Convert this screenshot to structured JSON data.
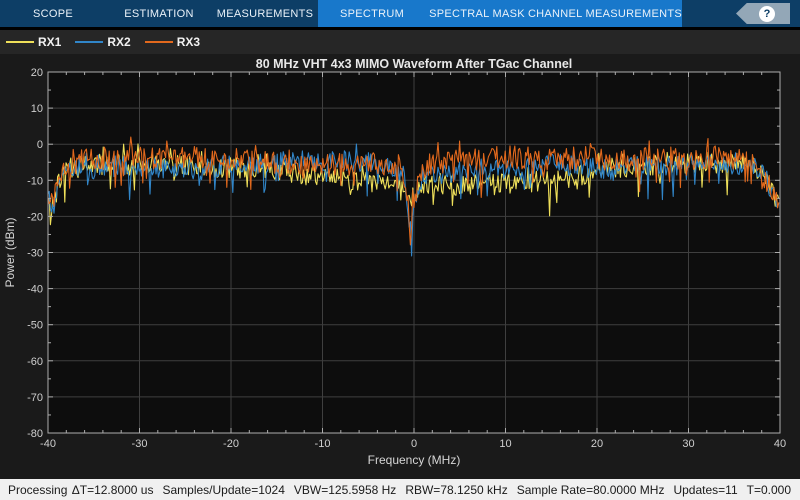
{
  "toolstrip": {
    "dark_tabs": [
      {
        "label": "SCOPE"
      },
      {
        "label": "ESTIMATION"
      },
      {
        "label": "MEASUREMENTS"
      }
    ],
    "blue_tabs": [
      {
        "label": "SPECTRUM"
      },
      {
        "label": "SPECTRAL MASK"
      },
      {
        "label": "CHANNEL MEASUREMENTS"
      }
    ],
    "help_label": "?",
    "colors": {
      "dark_bg": "#0D3E66",
      "blue_bg": "#1878CB",
      "help_tag": "#93A7B7"
    }
  },
  "legend": {
    "items": [
      {
        "label": "RX1",
        "color": "#EFE05A"
      },
      {
        "label": "RX2",
        "color": "#3186C9"
      },
      {
        "label": "RX3",
        "color": "#E2691D"
      }
    ]
  },
  "chart": {
    "title": "80 MHz VHT 4x3 MIMO Waveform After TGac Channel",
    "xlabel": "Frequency (MHz)",
    "ylabel": "Power (dBm)",
    "xlim": [
      -40,
      40
    ],
    "ylim": [
      -80,
      20
    ],
    "xticks": [
      -40,
      -30,
      -20,
      -10,
      0,
      10,
      20,
      30,
      40
    ],
    "yticks": [
      20,
      10,
      0,
      -10,
      -20,
      -30,
      -40,
      -50,
      -60,
      -70,
      -80
    ],
    "minor_x_step": 2,
    "minor_y_step": 5,
    "colors": {
      "figure_bg": "#1A1A1A",
      "plot_bg": "#0D0D0D",
      "grid": "#3F3F3F",
      "axis": "#ADADAD",
      "tick_text": "#CFCFCF",
      "label_text": "#D6D6D6"
    }
  },
  "chart_data": {
    "type": "line",
    "x_unit": "MHz",
    "y_unit": "dBm",
    "note": "Noisy spectral traces; envelope points [freq_MHz, dBm] estimated from plot, peak-to-peak noise ~6 dB with downward fading spikes",
    "series": [
      {
        "name": "RX1",
        "color": "#EFE05A",
        "seed": 42,
        "noise_db": 3.0,
        "envelope": [
          [
            -40,
            -15
          ],
          [
            -39.4,
            -18
          ],
          [
            -38.9,
            -11
          ],
          [
            -38,
            -7
          ],
          [
            -36,
            -6
          ],
          [
            -33,
            -5.5
          ],
          [
            -30,
            -5.5
          ],
          [
            -27,
            -6
          ],
          [
            -24,
            -6
          ],
          [
            -21,
            -6.5
          ],
          [
            -18,
            -7
          ],
          [
            -15,
            -7
          ],
          [
            -12,
            -8.5
          ],
          [
            -9,
            -9.5
          ],
          [
            -6,
            -10.5
          ],
          [
            -3,
            -11
          ],
          [
            -1,
            -12
          ],
          [
            -0.3,
            -17
          ],
          [
            0.5,
            -12
          ],
          [
            3,
            -11
          ],
          [
            6,
            -11.5
          ],
          [
            9,
            -11
          ],
          [
            12,
            -10.5
          ],
          [
            15,
            -10
          ],
          [
            18,
            -8.5
          ],
          [
            21,
            -7.5
          ],
          [
            24,
            -6.5
          ],
          [
            27,
            -6
          ],
          [
            30,
            -5
          ],
          [
            33,
            -5
          ],
          [
            35,
            -4.5
          ],
          [
            37,
            -6
          ],
          [
            38.3,
            -8
          ],
          [
            39,
            -12
          ],
          [
            39.5,
            -15
          ],
          [
            40,
            -16
          ]
        ]
      },
      {
        "name": "RX2",
        "color": "#3186C9",
        "seed": 777,
        "noise_db": 3.0,
        "envelope": [
          [
            -40,
            -14
          ],
          [
            -39.4,
            -19
          ],
          [
            -38.8,
            -10
          ],
          [
            -38,
            -7.5
          ],
          [
            -36,
            -7
          ],
          [
            -33,
            -6
          ],
          [
            -30,
            -6.5
          ],
          [
            -27,
            -7
          ],
          [
            -24,
            -7
          ],
          [
            -21,
            -6
          ],
          [
            -18,
            -6
          ],
          [
            -15,
            -5
          ],
          [
            -12,
            -4.5
          ],
          [
            -9,
            -4.5
          ],
          [
            -6,
            -5
          ],
          [
            -3,
            -5.5
          ],
          [
            -1,
            -8
          ],
          [
            -0.4,
            -24
          ],
          [
            0.4,
            -14
          ],
          [
            1.5,
            -9
          ],
          [
            4,
            -8
          ],
          [
            7,
            -7.5
          ],
          [
            10,
            -7
          ],
          [
            13,
            -6.5
          ],
          [
            15,
            -5.5
          ],
          [
            17,
            -6
          ],
          [
            20,
            -7
          ],
          [
            23,
            -6.5
          ],
          [
            26,
            -6
          ],
          [
            29,
            -5.5
          ],
          [
            32,
            -6
          ],
          [
            34,
            -6
          ],
          [
            36,
            -5.5
          ],
          [
            37.5,
            -7
          ],
          [
            38.5,
            -10
          ],
          [
            39.2,
            -14
          ],
          [
            40,
            -16
          ]
        ]
      },
      {
        "name": "RX3",
        "color": "#E2691D",
        "seed": 1309,
        "noise_db": 3.2,
        "envelope": [
          [
            -40,
            -13
          ],
          [
            -39.5,
            -17
          ],
          [
            -38.9,
            -9
          ],
          [
            -38,
            -5.5
          ],
          [
            -36,
            -4.5
          ],
          [
            -34,
            -4
          ],
          [
            -31,
            -3.5
          ],
          [
            -28,
            -4
          ],
          [
            -25,
            -3.5
          ],
          [
            -22,
            -4.5
          ],
          [
            -19,
            -4
          ],
          [
            -16,
            -5
          ],
          [
            -13,
            -6.5
          ],
          [
            -10,
            -6
          ],
          [
            -7,
            -5.5
          ],
          [
            -4,
            -5
          ],
          [
            -1.5,
            -5.5
          ],
          [
            -0.4,
            -21
          ],
          [
            0.5,
            -10
          ],
          [
            1.5,
            -5.5
          ],
          [
            4,
            -4.5
          ],
          [
            7,
            -4
          ],
          [
            10,
            -3.5
          ],
          [
            13,
            -4
          ],
          [
            16,
            -4.5
          ],
          [
            19,
            -4
          ],
          [
            22,
            -4.5
          ],
          [
            25,
            -4
          ],
          [
            28,
            -4.5
          ],
          [
            31,
            -4
          ],
          [
            33,
            -3.5
          ],
          [
            35,
            -4
          ],
          [
            36.5,
            -4.5
          ],
          [
            37.8,
            -7
          ],
          [
            38.7,
            -11
          ],
          [
            39.4,
            -15
          ],
          [
            40,
            -15.5
          ]
        ]
      }
    ]
  },
  "status_bar": {
    "left": "Processing",
    "fields": [
      "ΔT=12.8000 us",
      "Samples/Update=1024",
      "VBW=125.5958 Hz",
      "RBW=78.1250 kHz",
      "Sample Rate=80.0000 MHz",
      "Updates=11",
      "T=0.000"
    ]
  }
}
